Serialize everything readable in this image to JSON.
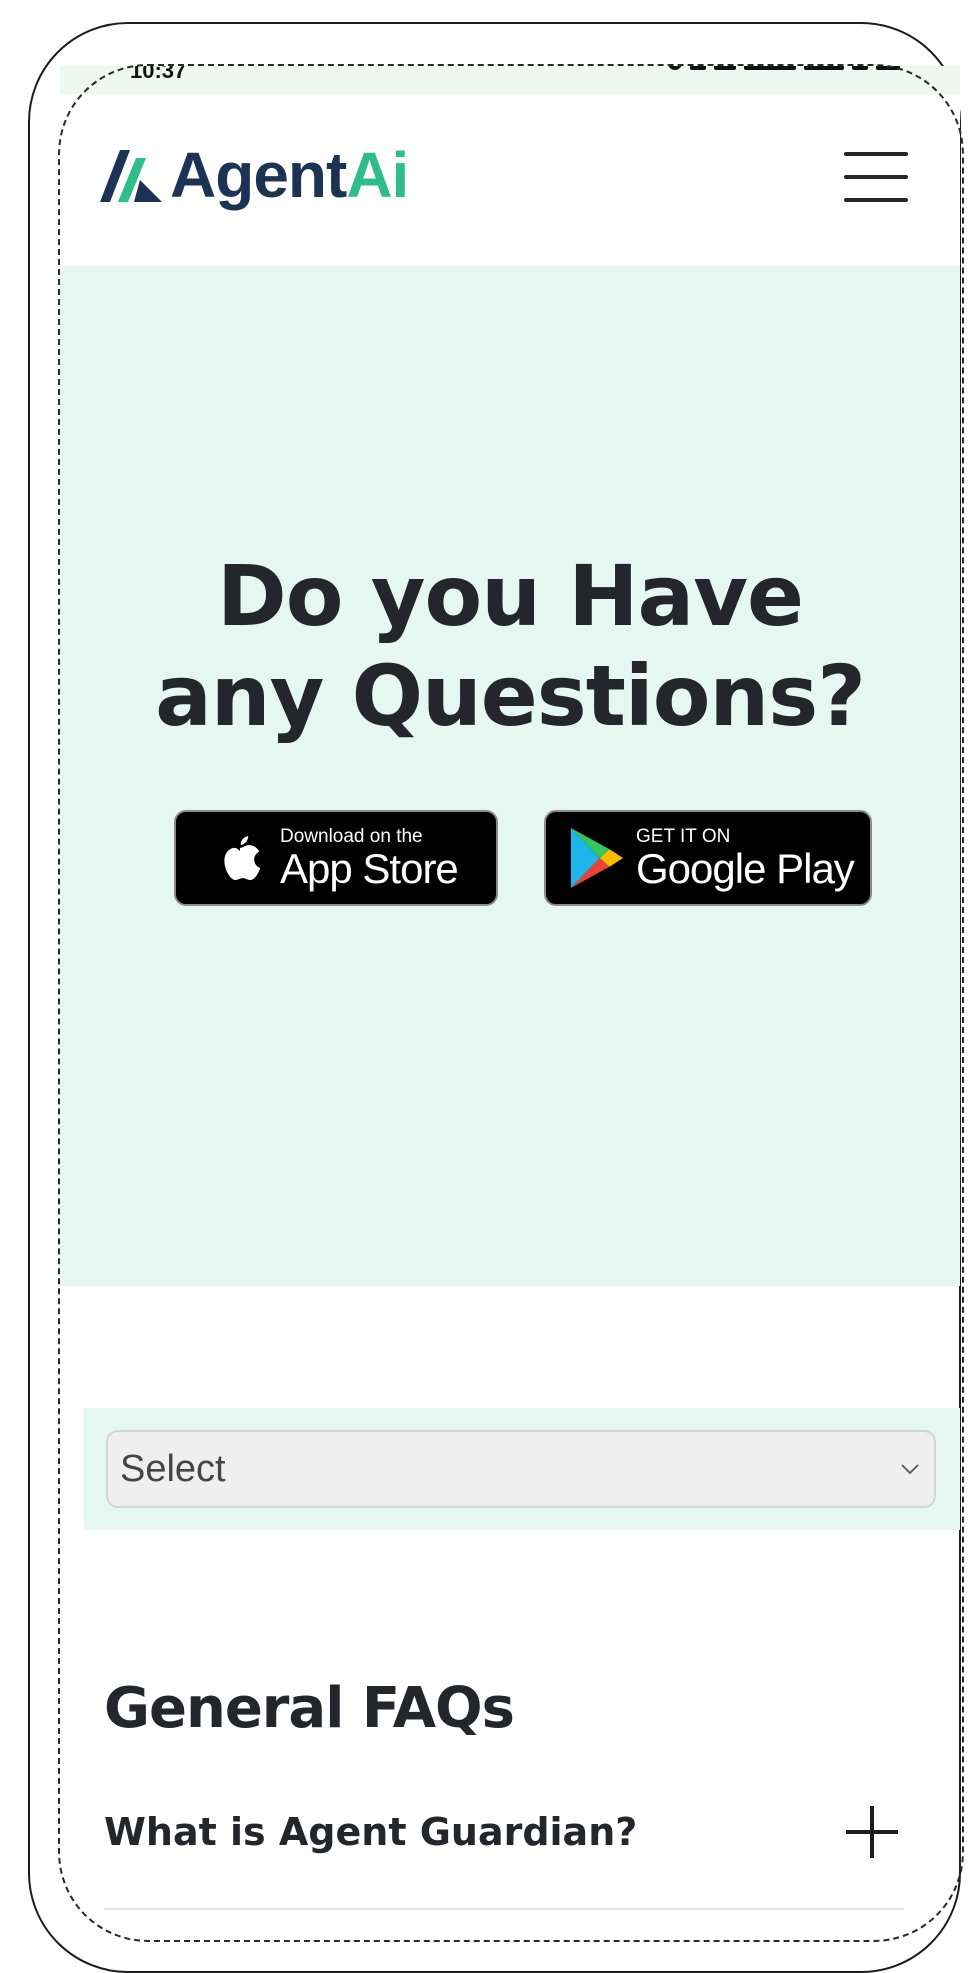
{
  "status_bar": {
    "left_text": "10:37"
  },
  "header": {
    "logo": {
      "text_primary": "Agent",
      "text_accent": "Ai",
      "primary_color": "#1d3355",
      "accent_color": "#2fbd8c"
    },
    "menu_icon": "hamburger-menu-icon"
  },
  "hero": {
    "title_line1": "Do you Have",
    "title_line2": "any Questions?",
    "background": "#e6f6f0",
    "app_store": {
      "small": "Download on the",
      "large": "App Store",
      "icon": "apple-icon"
    },
    "google_play": {
      "small": "GET IT ON",
      "large": "Google Play",
      "icon": "google-play-icon"
    }
  },
  "filter": {
    "selected": "Select",
    "icon": "chevron-down-icon"
  },
  "faq": {
    "title": "General FAQs",
    "items": [
      {
        "question": "What is Agent Guardian?",
        "icon": "plus-icon"
      }
    ]
  }
}
